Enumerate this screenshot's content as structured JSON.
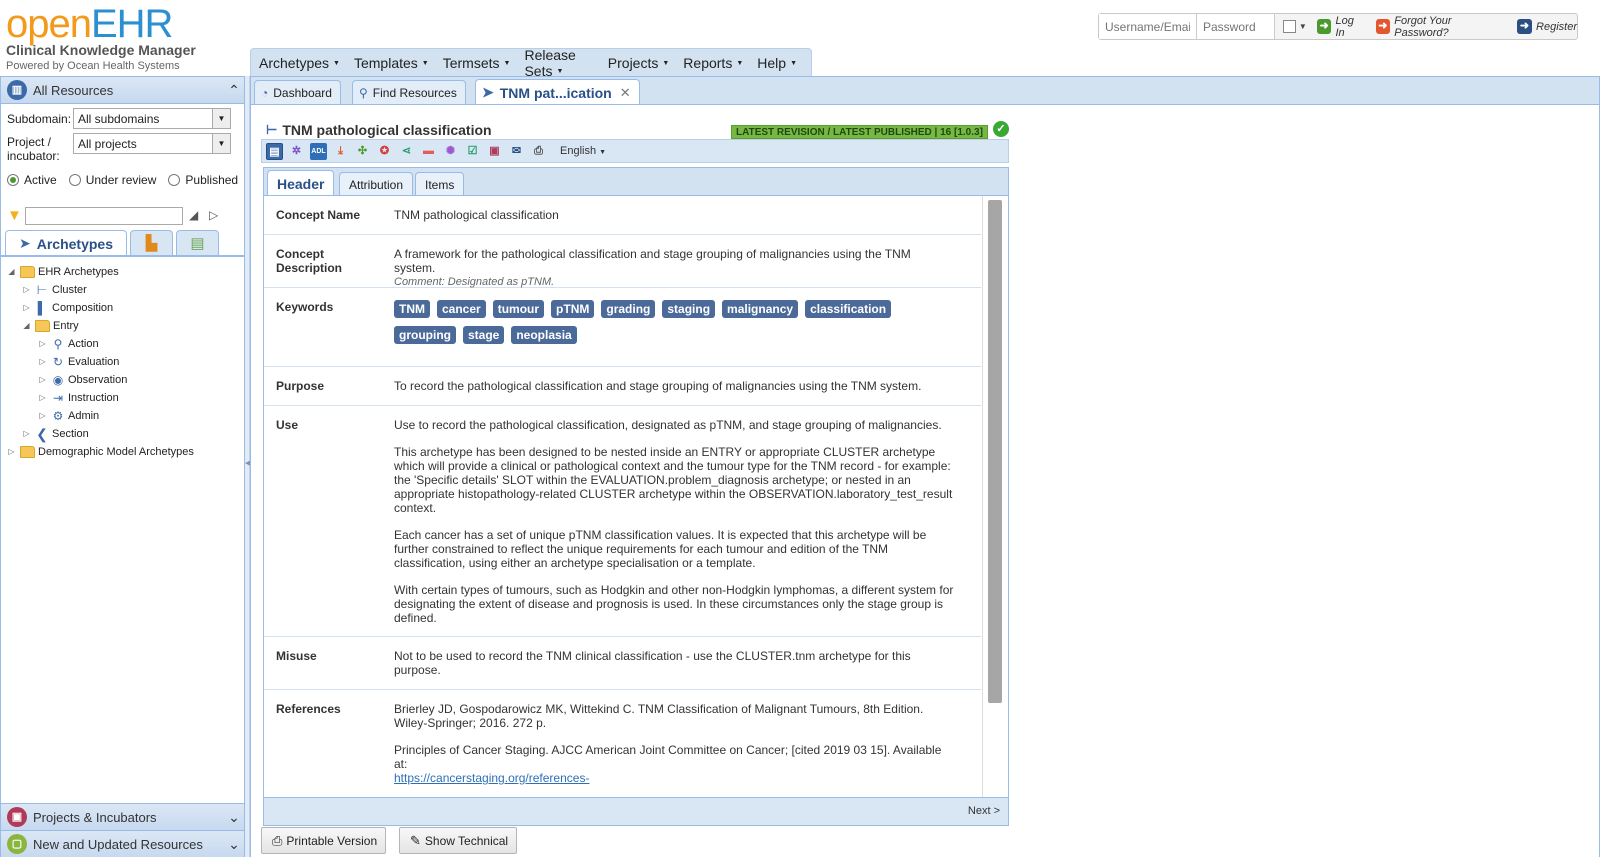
{
  "brand": {
    "logo_part1": "open",
    "logo_part2": "EHR",
    "subtitle": "Clinical Knowledge Manager",
    "powered_by": "Powered by Ocean Health Systems"
  },
  "login": {
    "username_placeholder": "Username/Email",
    "password_placeholder": "Password",
    "log_in": "Log In",
    "forgot": "Forgot Your Password?",
    "register": "Register"
  },
  "menu": [
    "Archetypes",
    "Templates",
    "Termsets",
    "Release Sets",
    "Projects",
    "Reports",
    "Help"
  ],
  "left": {
    "title": "All Resources",
    "subdomain_label": "Subdomain:",
    "subdomain_value": "All subdomains",
    "project_label_1": "Project /",
    "project_label_2": "incubator:",
    "project_value": "All projects",
    "status_active": "Active",
    "status_review": "Under review",
    "status_published": "Published",
    "tab_archetypes": "Archetypes",
    "tree": {
      "ehr": "EHR Archetypes",
      "cluster": "Cluster",
      "composition": "Composition",
      "entry": "Entry",
      "action": "Action",
      "evaluation": "Evaluation",
      "observation": "Observation",
      "instruction": "Instruction",
      "admin": "Admin",
      "section": "Section",
      "demographic": "Demographic Model Archetypes"
    },
    "projects_incubators": "Projects & Incubators",
    "new_updated": "New and Updated Resources"
  },
  "tabs": {
    "dashboard": "Dashboard",
    "find": "Find Resources",
    "doc": "TNM pat...ication"
  },
  "doc": {
    "title": "TNM pathological classification",
    "status": "LATEST REVISION / LATEST PUBLISHED | 16 [1.0.3]",
    "language": "English",
    "tab_header": "Header",
    "tab_attribution": "Attribution",
    "tab_items": "Items",
    "concept_name_label": "Concept Name",
    "concept_name": "TNM pathological classification",
    "concept_desc_label_1": "Concept",
    "concept_desc_label_2": "Description",
    "concept_desc": "A framework for the pathological classification and stage grouping of malignancies using the TNM system.",
    "concept_comment": "Comment: Designated as pTNM.",
    "keywords_label": "Keywords",
    "keywords": [
      "TNM",
      "cancer",
      "tumour",
      "pTNM",
      "grading",
      "staging",
      "malignancy",
      "classification",
      "grouping",
      "stage",
      "neoplasia"
    ],
    "purpose_label": "Purpose",
    "purpose": "To record the pathological classification and stage grouping of malignancies using the TNM system.",
    "use_label": "Use",
    "use_1": "Use to record the pathological classification, designated as pTNM, and stage grouping of malignancies.",
    "use_2": "This archetype has been designed to be nested inside an ENTRY or appropriate CLUSTER archetype which will provide a clinical or pathological context and the tumour type for the TNM record - for example: the 'Specific details' SLOT within the EVALUATION.problem_diagnosis archetype; or nested in an appropriate histopathology-related CLUSTER archetype within the OBSERVATION.laboratory_test_result context.",
    "use_3": "Each cancer has a set of unique pTNM classification values. It is expected that this archetype will be further constrained to reflect the unique requirements for each tumour and edition of the TNM classification, using either an archetype specialisation or a template.",
    "use_4": "With certain types of tumours, such as Hodgkin and other non-Hodgkin lymphomas, a different system for designating the extent of disease and prognosis is used. In these circumstances only the stage group is defined.",
    "misuse_label": "Misuse",
    "misuse": "Not to be used to record the TNM clinical classification - use the CLUSTER.tnm archetype for this purpose.",
    "references_label": "References",
    "ref_1": "Brierley JD, Gospodarowicz MK, Wittekind C. TNM Classification of Malignant Tumours, 8th Edition. Wiley-Springer; 2016. 272 p.",
    "ref_2": "Principles of Cancer Staging. AJCC American Joint Committee on Cancer; [cited 2019 03 15]. Available at:",
    "ref_2_link": "https://cancerstaging.org/references-",
    "next": "Next >",
    "printable": "Printable Version",
    "show_technical": "Show Technical"
  },
  "colors": {
    "accent_blue": "#2b8fd0",
    "accent_orange": "#f39a1c",
    "status_green": "#77b844",
    "keyword_bg": "#4b6a9a"
  }
}
